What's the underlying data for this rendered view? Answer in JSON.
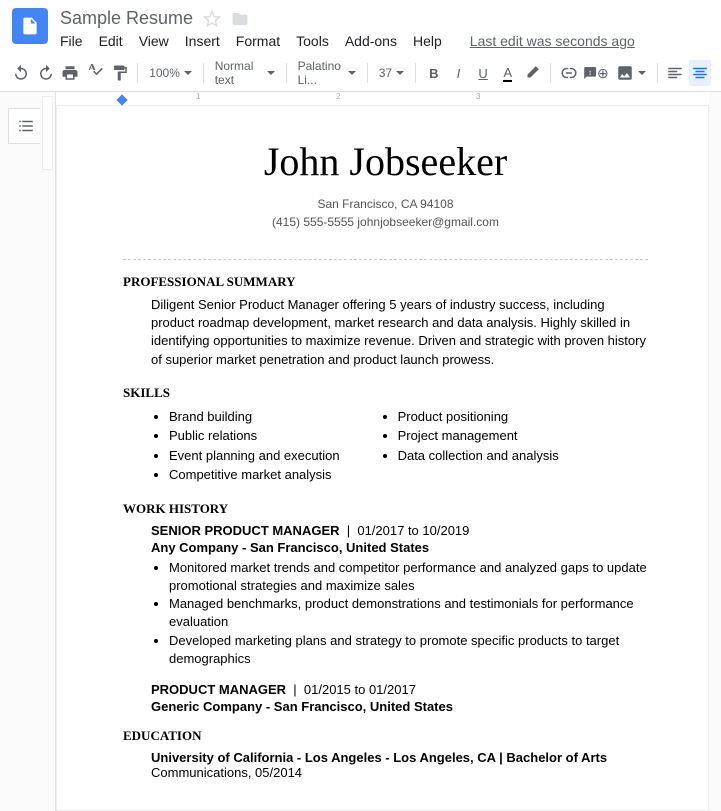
{
  "header": {
    "title": "Sample Resume",
    "menus": [
      "File",
      "Edit",
      "View",
      "Insert",
      "Format",
      "Tools",
      "Add-ons",
      "Help"
    ],
    "lastEdit": "Last edit was seconds ago"
  },
  "toolbar": {
    "zoom": "100%",
    "style": "Normal text",
    "font": "Palatino Li...",
    "fontSize": "37"
  },
  "resume": {
    "name": "John Jobseeker",
    "location": "San Francisco, CA 94108",
    "phoneEmail": "(415) 555-5555 johnjobseeker@gmail.com",
    "summaryHeading": "PROFESSIONAL SUMMARY",
    "summary": "Diligent Senior Product Manager offering 5 years of industry success, including product roadmap development, market research and data analysis. Highly skilled in identifying opportunities to maximize revenue. Driven and strategic with proven history of superior market penetration and product launch prowess.",
    "skillsHeading": "SKILLS",
    "skillsLeft": [
      "Brand building",
      "Public relations",
      "Event planning and execution",
      "Competitive market analysis"
    ],
    "skillsRight": [
      "Product positioning",
      "Project management",
      "Data collection and analysis"
    ],
    "workHeading": "WORK HISTORY",
    "jobs": [
      {
        "title": "SENIOR PRODUCT MANAGER",
        "dates": "01/2017 to 10/2019",
        "company": "Any Company - San Francisco, United States",
        "bullets": [
          "Monitored market trends and competitor performance and analyzed gaps to update promotional strategies and maximize sales",
          "Managed benchmarks, product demonstrations and testimonials for performance evaluation",
          "Developed marketing plans and strategy to promote specific products to target demographics"
        ]
      },
      {
        "title": "PRODUCT MANAGER",
        "dates": "01/2015 to 01/2017",
        "company": "Generic Company - San Francisco, United States",
        "bullets": []
      }
    ],
    "eduHeading": "EDUCATION",
    "education": {
      "line1": "University of California - Los Angeles - Los Angeles, CA  |  Bachelor of Arts",
      "line2": "Communications, 05/2014"
    }
  }
}
